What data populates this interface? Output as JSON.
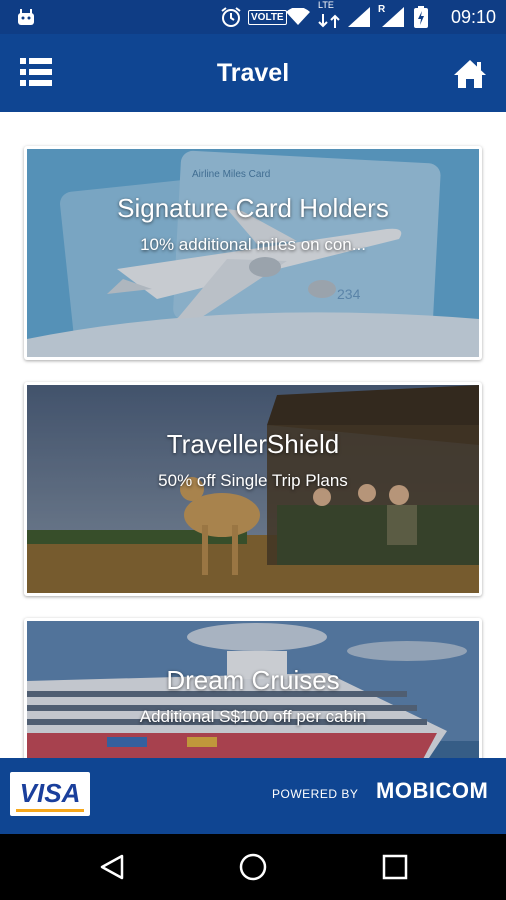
{
  "status_bar": {
    "time": "09:10",
    "volte": "VOLTE",
    "lte": "LTE",
    "roaming": "R",
    "icons": [
      "android-icon",
      "alarm-icon",
      "volte-icon",
      "wifi-icon",
      "lte-icon",
      "signal-icon",
      "signal-roaming-icon",
      "battery-charging-icon"
    ]
  },
  "app_bar": {
    "title": "Travel",
    "menu_icon": "list-menu-icon",
    "home_icon": "home-icon"
  },
  "cards": [
    {
      "title": "Signature Card Holders",
      "subtitle": "10% additional miles on con...",
      "image_text": "Airline Miles Card",
      "image_text_2": "234"
    },
    {
      "title": "TravellerShield",
      "subtitle": "50% off Single Trip Plans"
    },
    {
      "title": "Dream Cruises",
      "subtitle": "Additional S$100 off per cabin"
    }
  ],
  "footer": {
    "visa": "VISA",
    "powered_by": "POWERED BY",
    "brand": "MOBICOM"
  },
  "nav": {
    "icons": [
      "back-icon",
      "home-circle-icon",
      "recents-icon"
    ]
  },
  "colors": {
    "primary": "#0f4592",
    "status": "#0f3d85",
    "visa_blue": "#1a3f9c",
    "visa_gold": "#f6a81c"
  }
}
